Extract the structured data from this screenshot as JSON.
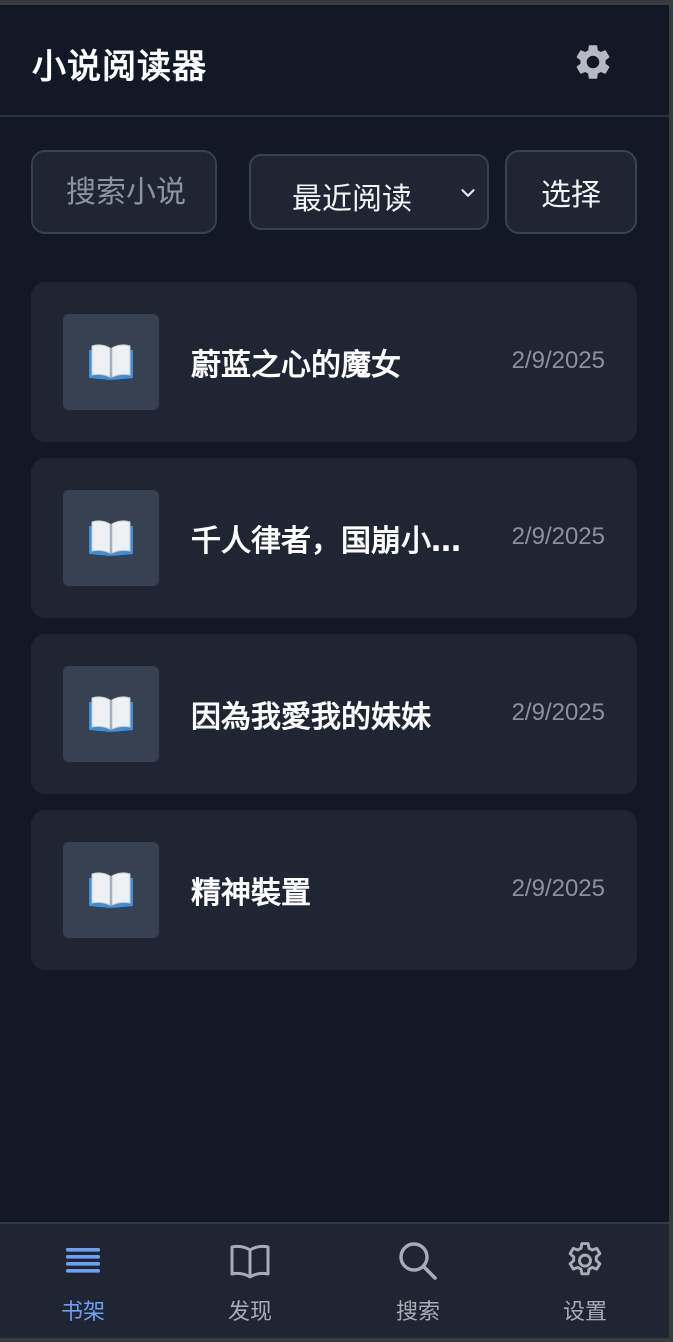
{
  "header": {
    "title": "小说阅读器",
    "settings_icon": "gear-icon"
  },
  "toolbar": {
    "search_placeholder": "搜索小说",
    "search_value": "",
    "sort_selected": "最近阅读",
    "select_label": "选择"
  },
  "books": [
    {
      "title": "蔚蓝之心的魔女",
      "date": "2/9/2025",
      "cover_icon": "book-icon"
    },
    {
      "title": "千人律者，国崩小鸟游",
      "date": "2/9/2025",
      "cover_icon": "book-icon"
    },
    {
      "title": "因為我愛我的妹妹",
      "date": "2/9/2025",
      "cover_icon": "book-icon"
    },
    {
      "title": "精神裝置",
      "date": "2/9/2025",
      "cover_icon": "book-icon"
    }
  ],
  "nav": {
    "items": [
      {
        "label": "书架",
        "icon": "bookshelf-icon",
        "active": true
      },
      {
        "label": "发现",
        "icon": "open-book-icon",
        "active": false
      },
      {
        "label": "搜索",
        "icon": "search-icon",
        "active": false
      },
      {
        "label": "设置",
        "icon": "gear-icon",
        "active": false
      }
    ]
  },
  "colors": {
    "background": "#121826",
    "card": "#1f2533",
    "accent": "#6e9ff2",
    "muted_text": "#8b919e"
  }
}
